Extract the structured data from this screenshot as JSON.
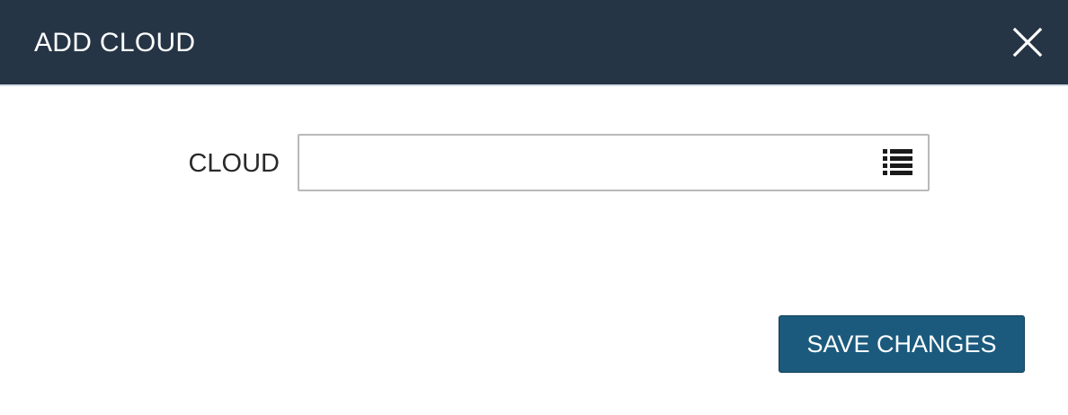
{
  "modal": {
    "title": "ADD CLOUD",
    "close_icon": "close-icon"
  },
  "form": {
    "cloud_label": "CLOUD",
    "cloud_value": "",
    "cloud_picker_icon": "list-icon"
  },
  "footer": {
    "save_label": "SAVE CHANGES"
  },
  "colors": {
    "header_bg": "#253546",
    "button_bg": "#1b5a7d",
    "field_border": "#b9b9b9"
  }
}
